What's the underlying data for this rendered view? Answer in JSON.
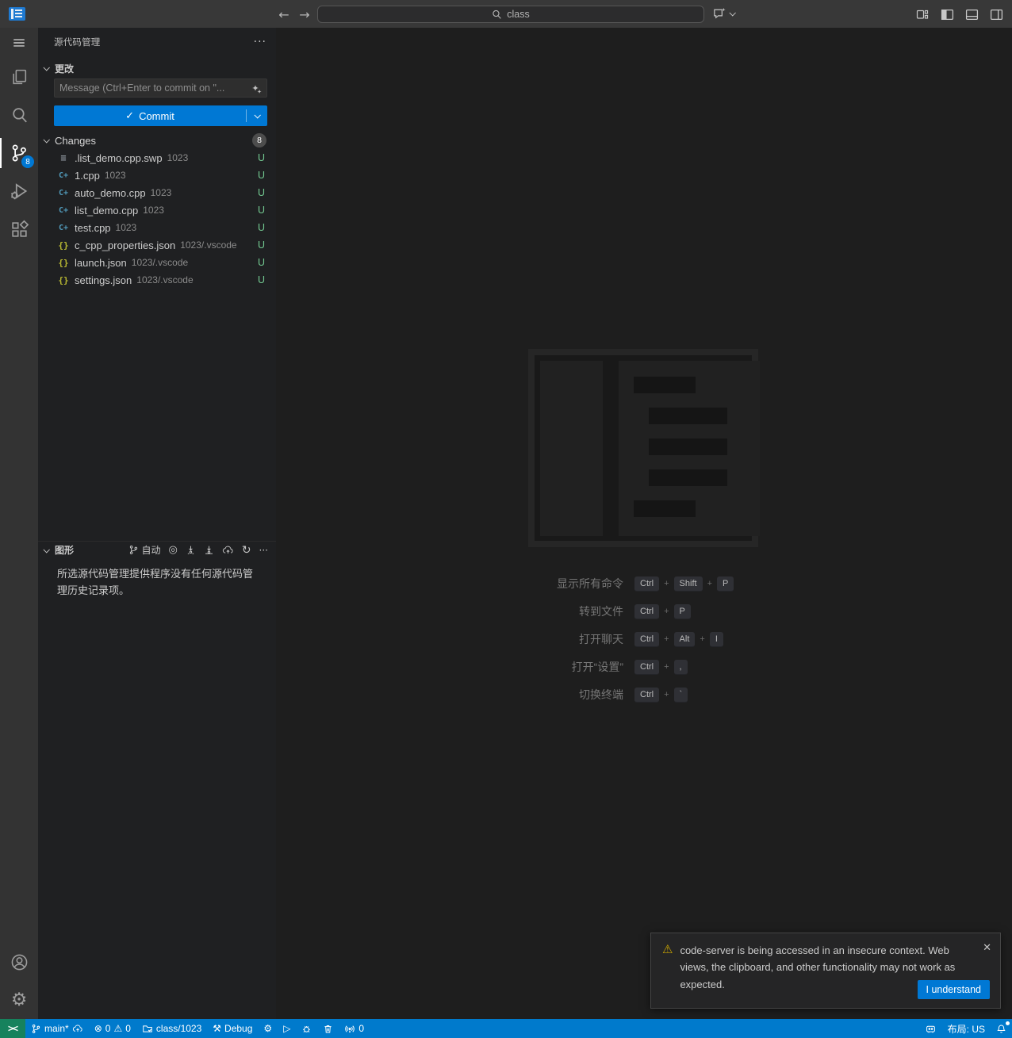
{
  "titlebar": {
    "search_value": "class"
  },
  "icons": {
    "more": "···",
    "check": "✓",
    "sparkle_big": "✦",
    "sparkle_small": "✦",
    "back_arrow": "←",
    "forward_arrow": "→",
    "gear": "⚙",
    "play": "▷",
    "error_circle": "⊗",
    "warning_triangle": "⚠",
    "tools": "⚒",
    "target": "◎",
    "refresh": "↻",
    "close": "✕"
  },
  "activity_bar": {
    "scm_badge": "8"
  },
  "sidebar": {
    "title": "源代码管理",
    "changes_section_label": "更改",
    "message_placeholder": "Message (Ctrl+Enter to commit on \"...",
    "commit_label": "Commit",
    "changes_tree_label": "Changes",
    "changes_count": "8",
    "file_icon_glyphs": {
      "cpp": "C+",
      "json": "{}",
      "swp": "≡"
    },
    "files": [
      {
        "icon": "swp",
        "name": ".list_demo.cpp.swp",
        "desc": "1023",
        "status": "U"
      },
      {
        "icon": "cpp",
        "name": "1.cpp",
        "desc": "1023",
        "status": "U"
      },
      {
        "icon": "cpp",
        "name": "auto_demo.cpp",
        "desc": "1023",
        "status": "U"
      },
      {
        "icon": "cpp",
        "name": "list_demo.cpp",
        "desc": "1023",
        "status": "U"
      },
      {
        "icon": "cpp",
        "name": "test.cpp",
        "desc": "1023",
        "status": "U"
      },
      {
        "icon": "json",
        "name": "c_cpp_properties.json",
        "desc": "1023/.vscode",
        "status": "U"
      },
      {
        "icon": "json",
        "name": "launch.json",
        "desc": "1023/.vscode",
        "status": "U"
      },
      {
        "icon": "json",
        "name": "settings.json",
        "desc": "1023/.vscode",
        "status": "U"
      }
    ],
    "graph": {
      "label": "图形",
      "auto_label": "自动",
      "empty_message": "所选源代码管理提供程序没有任何源代码管理历史记录项。"
    }
  },
  "editor": {
    "shortcuts": [
      {
        "label": "显示所有命令",
        "keys": [
          "Ctrl",
          "Shift",
          "P"
        ]
      },
      {
        "label": "转到文件",
        "keys": [
          "Ctrl",
          "P"
        ]
      },
      {
        "label": "打开聊天",
        "keys": [
          "Ctrl",
          "Alt",
          "I"
        ]
      },
      {
        "label": "打开“设置”",
        "keys": [
          "Ctrl",
          ","
        ]
      },
      {
        "label": "切换终端",
        "keys": [
          "Ctrl",
          "`"
        ]
      }
    ]
  },
  "notification": {
    "message": "code-server is being accessed in an insecure context. Web views, the clipboard, and other functionality may not work as expected.",
    "button_label": "I understand"
  },
  "statusbar": {
    "remote_label": "><",
    "branch": "main*",
    "errors": "0",
    "warnings": "0",
    "folder": "class/1023",
    "debug": "Debug",
    "ports": "0",
    "layout": "布局: US"
  },
  "colors": {
    "statusbar": "#007acc",
    "remote_badge": "#16825d",
    "accent_button": "#0078d4",
    "untracked_green": "#73c991",
    "warning_yellow": "#cca700",
    "cpp_icon_blue": "#519aba",
    "json_icon_yellow": "#b8b832"
  }
}
